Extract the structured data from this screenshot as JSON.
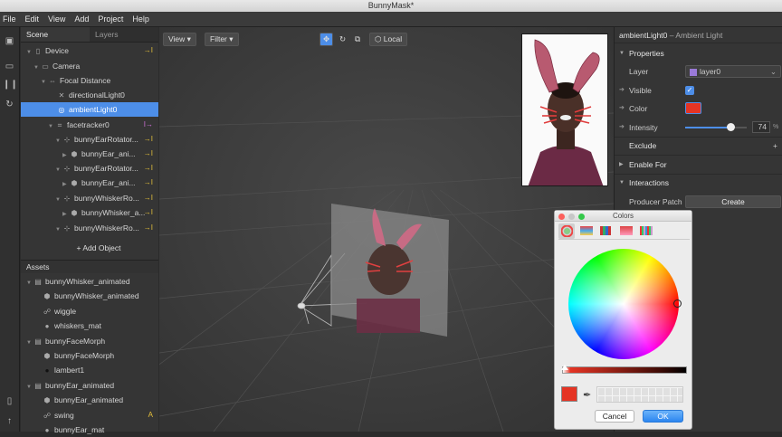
{
  "window": {
    "title": "BunnyMask*"
  },
  "menu": [
    "File",
    "Edit",
    "View",
    "Add",
    "Project",
    "Help"
  ],
  "scene_panel": {
    "tabs": [
      "Scene",
      "Layers"
    ],
    "tree": [
      {
        "label": "Device",
        "badge": "→I"
      },
      {
        "label": "Camera"
      },
      {
        "label": "Focal Distance"
      },
      {
        "label": "directionalLight0"
      },
      {
        "label": "ambientLight0",
        "selected": true
      },
      {
        "label": "facetracker0",
        "badge": "I→"
      },
      {
        "label": "bunnyEarRotator...",
        "badge": "→I"
      },
      {
        "label": "bunnyEar_ani...",
        "badge": "→I"
      },
      {
        "label": "bunnyEarRotator...",
        "badge": "→I"
      },
      {
        "label": "bunnyEar_ani...",
        "badge": "→I"
      },
      {
        "label": "bunnyWhiskerRo...",
        "badge": "→I"
      },
      {
        "label": "bunnyWhisker_a...",
        "badge": "→I"
      },
      {
        "label": "bunnyWhiskerRo...",
        "badge": "→I"
      }
    ],
    "add_object": "+ Add Object"
  },
  "assets_panel": {
    "header": "Assets",
    "items": [
      {
        "label": "bunnyWhisker_animated"
      },
      {
        "label": "bunnyWhisker_animated"
      },
      {
        "label": "wiggle"
      },
      {
        "label": "whiskers_mat"
      },
      {
        "label": "bunnyFaceMorph"
      },
      {
        "label": "bunnyFaceMorph"
      },
      {
        "label": "lambert1"
      },
      {
        "label": "bunnyEar_animated"
      },
      {
        "label": "bunnyEar_animated"
      },
      {
        "label": "swing",
        "badge": "A"
      },
      {
        "label": "bunnyEar_mat"
      }
    ]
  },
  "viewport": {
    "view_label": "View",
    "filter_label": "Filter",
    "local_label": "Local"
  },
  "inspector": {
    "title": "ambientLight0",
    "subtitle": "– Ambient Light",
    "properties_label": "Properties",
    "layer_label": "Layer",
    "layer_value": "layer0",
    "visible_label": "Visible",
    "color_label": "Color",
    "color_value": "#e53424",
    "intensity_label": "Intensity",
    "intensity_value": "74",
    "intensity_unit": "%",
    "intensity_fraction": 0.74,
    "exclude_label": "Exclude",
    "enable_for_label": "Enable For",
    "interactions_label": "Interactions",
    "producer_patch_label": "Producer Patch",
    "create_label": "Create"
  },
  "colors_dialog": {
    "title": "Colors",
    "cancel_label": "Cancel",
    "ok_label": "OK",
    "selected_color": "#e53424"
  }
}
